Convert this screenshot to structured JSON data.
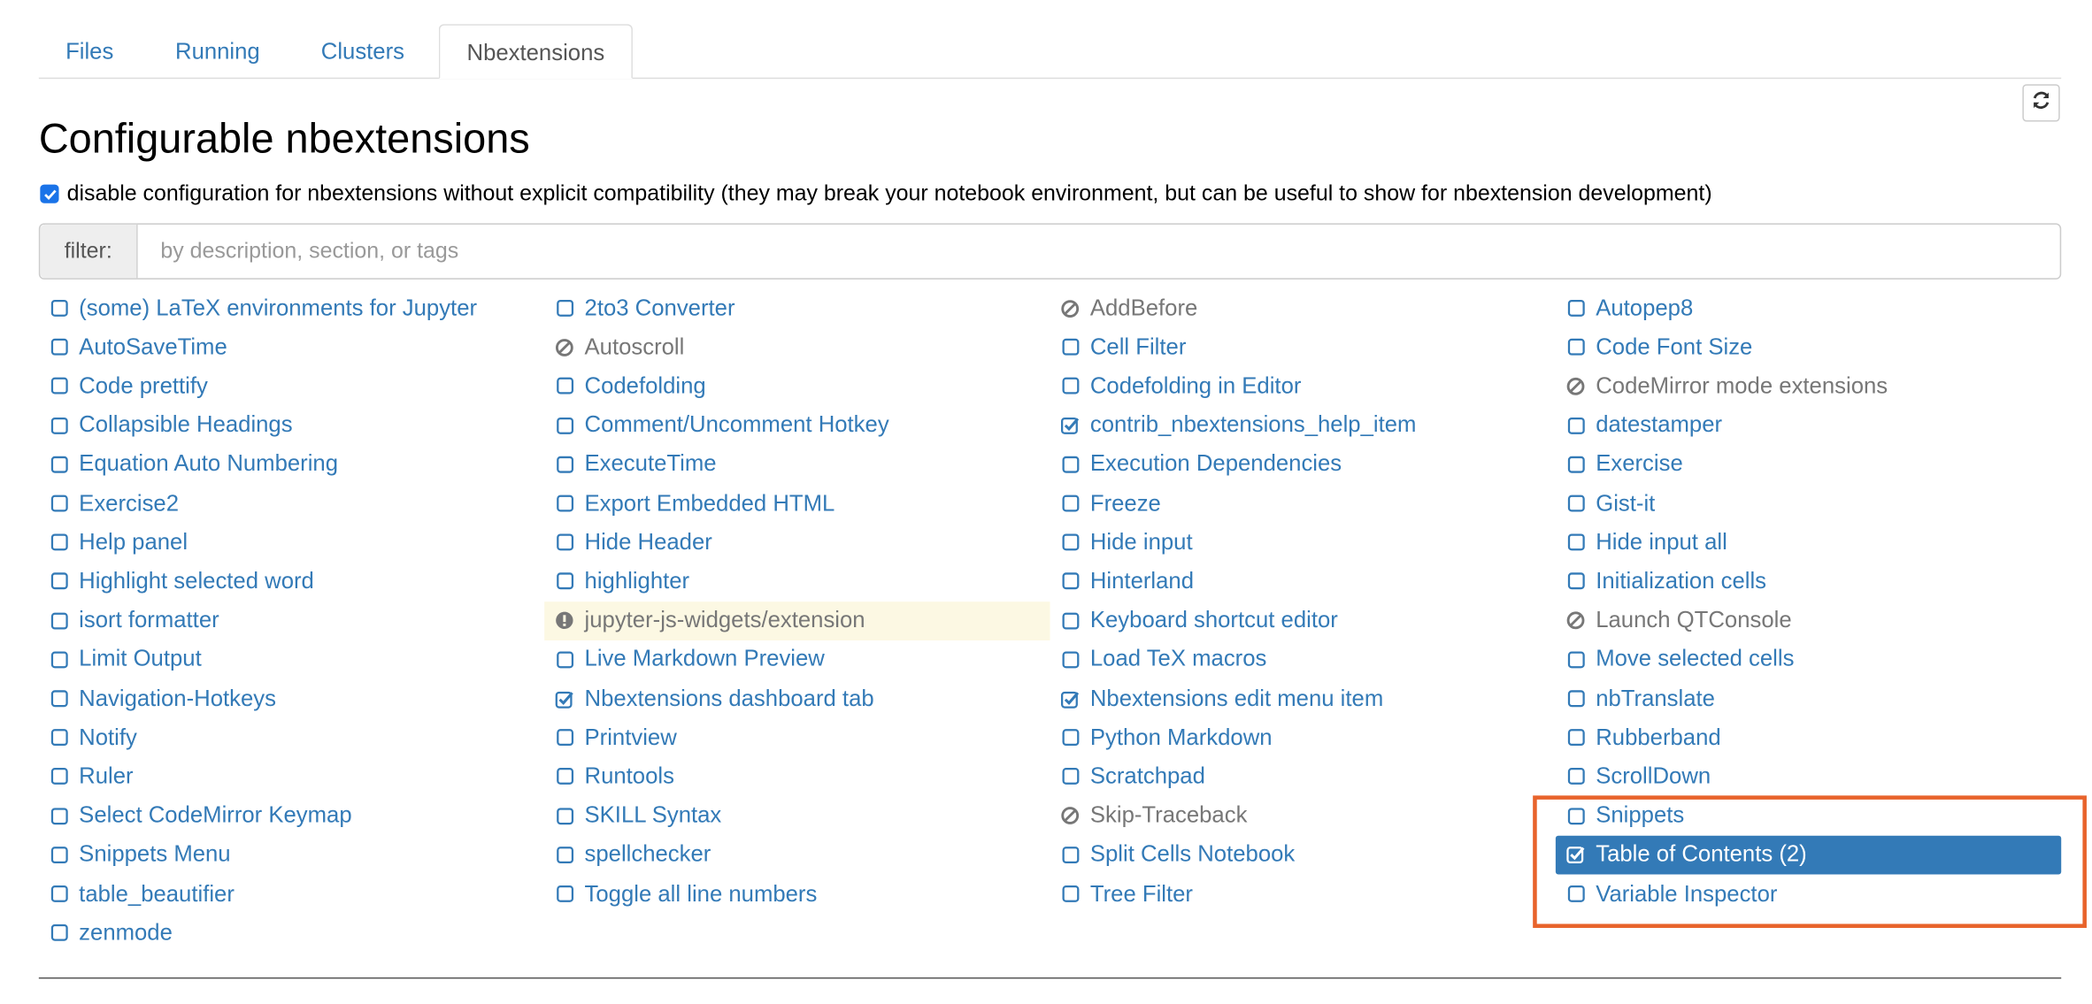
{
  "tabs": [
    {
      "label": "Files",
      "active": false
    },
    {
      "label": "Running",
      "active": false
    },
    {
      "label": "Clusters",
      "active": false
    },
    {
      "label": "Nbextensions",
      "active": true
    }
  ],
  "page_title": "Configurable nbextensions",
  "compat_checkbox": {
    "checked": true,
    "label": "disable configuration for nbextensions without explicit compatibility (they may break your notebook environment, but can be useful to show for nbextension development)"
  },
  "filter": {
    "label": "filter:",
    "placeholder": "by description, section, or tags",
    "value": ""
  },
  "refresh_button": {
    "icon": "refresh-icon"
  },
  "colors": {
    "link": "#337ab7",
    "incompatible": "#777777",
    "warning_bg": "#fcf8e3",
    "selected_bg": "#337ab7",
    "highlight_box": "#e8632b",
    "checkbox_accent": "#1a73e8"
  },
  "extension_columns": [
    [
      {
        "label": "(some) LaTeX environments for Jupyter",
        "state": "unchecked"
      },
      {
        "label": "AutoSaveTime",
        "state": "unchecked"
      },
      {
        "label": "Code prettify",
        "state": "unchecked"
      },
      {
        "label": "Collapsible Headings",
        "state": "unchecked"
      },
      {
        "label": "Equation Auto Numbering",
        "state": "unchecked"
      },
      {
        "label": "Exercise2",
        "state": "unchecked"
      },
      {
        "label": "Help panel",
        "state": "unchecked"
      },
      {
        "label": "Highlight selected word",
        "state": "unchecked"
      },
      {
        "label": "isort formatter",
        "state": "unchecked"
      },
      {
        "label": "Limit Output",
        "state": "unchecked"
      },
      {
        "label": "Navigation-Hotkeys",
        "state": "unchecked"
      },
      {
        "label": "Notify",
        "state": "unchecked"
      },
      {
        "label": "Ruler",
        "state": "unchecked"
      },
      {
        "label": "Select CodeMirror Keymap",
        "state": "unchecked"
      },
      {
        "label": "Snippets Menu",
        "state": "unchecked"
      },
      {
        "label": "table_beautifier",
        "state": "unchecked"
      },
      {
        "label": "zenmode",
        "state": "unchecked"
      }
    ],
    [
      {
        "label": "2to3 Converter",
        "state": "unchecked"
      },
      {
        "label": "Autoscroll",
        "state": "incompatible"
      },
      {
        "label": "Codefolding",
        "state": "unchecked"
      },
      {
        "label": "Comment/Uncomment Hotkey",
        "state": "unchecked"
      },
      {
        "label": "ExecuteTime",
        "state": "unchecked"
      },
      {
        "label": "Export Embedded HTML",
        "state": "unchecked"
      },
      {
        "label": "Hide Header",
        "state": "unchecked"
      },
      {
        "label": "highlighter",
        "state": "unchecked"
      },
      {
        "label": "jupyter-js-widgets/extension",
        "state": "warning"
      },
      {
        "label": "Live Markdown Preview",
        "state": "unchecked"
      },
      {
        "label": "Nbextensions dashboard tab",
        "state": "checked"
      },
      {
        "label": "Printview",
        "state": "unchecked"
      },
      {
        "label": "Runtools",
        "state": "unchecked"
      },
      {
        "label": "SKILL Syntax",
        "state": "unchecked"
      },
      {
        "label": "spellchecker",
        "state": "unchecked"
      },
      {
        "label": "Toggle all line numbers",
        "state": "unchecked"
      }
    ],
    [
      {
        "label": "AddBefore",
        "state": "incompatible"
      },
      {
        "label": "Cell Filter",
        "state": "unchecked"
      },
      {
        "label": "Codefolding in Editor",
        "state": "unchecked"
      },
      {
        "label": "contrib_nbextensions_help_item",
        "state": "checked"
      },
      {
        "label": "Execution Dependencies",
        "state": "unchecked"
      },
      {
        "label": "Freeze",
        "state": "unchecked"
      },
      {
        "label": "Hide input",
        "state": "unchecked"
      },
      {
        "label": "Hinterland",
        "state": "unchecked"
      },
      {
        "label": "Keyboard shortcut editor",
        "state": "unchecked"
      },
      {
        "label": "Load TeX macros",
        "state": "unchecked"
      },
      {
        "label": "Nbextensions edit menu item",
        "state": "checked"
      },
      {
        "label": "Python Markdown",
        "state": "unchecked"
      },
      {
        "label": "Scratchpad",
        "state": "unchecked"
      },
      {
        "label": "Skip-Traceback",
        "state": "incompatible"
      },
      {
        "label": "Split Cells Notebook",
        "state": "unchecked"
      },
      {
        "label": "Tree Filter",
        "state": "unchecked"
      }
    ],
    [
      {
        "label": "Autopep8",
        "state": "unchecked"
      },
      {
        "label": "Code Font Size",
        "state": "unchecked"
      },
      {
        "label": "CodeMirror mode extensions",
        "state": "incompatible"
      },
      {
        "label": "datestamper",
        "state": "unchecked"
      },
      {
        "label": "Exercise",
        "state": "unchecked"
      },
      {
        "label": "Gist-it",
        "state": "unchecked"
      },
      {
        "label": "Hide input all",
        "state": "unchecked"
      },
      {
        "label": "Initialization cells",
        "state": "unchecked"
      },
      {
        "label": "Launch QTConsole",
        "state": "incompatible"
      },
      {
        "label": "Move selected cells",
        "state": "unchecked"
      },
      {
        "label": "nbTranslate",
        "state": "unchecked"
      },
      {
        "label": "Rubberband",
        "state": "unchecked"
      },
      {
        "label": "ScrollDown",
        "state": "unchecked"
      },
      {
        "label": "Snippets",
        "state": "unchecked"
      },
      {
        "label": "Table of Contents (2)",
        "state": "checked",
        "selected": true
      },
      {
        "label": "Variable Inspector",
        "state": "unchecked"
      }
    ]
  ]
}
